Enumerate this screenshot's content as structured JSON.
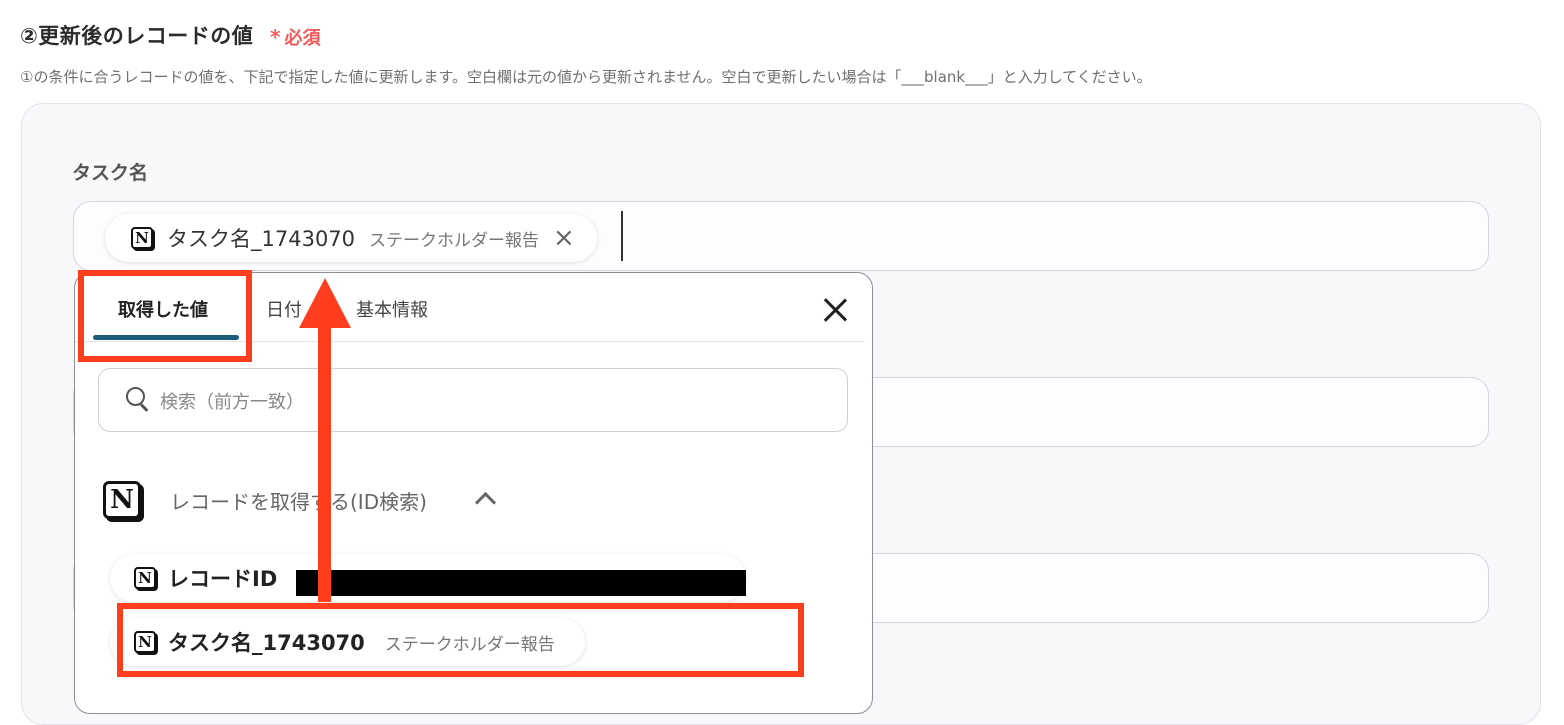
{
  "section": {
    "title": "②更新後のレコードの値",
    "required_mark": "*",
    "required_label": "必須",
    "description": "①の条件に合うレコードの値を、下記で指定した値に更新します。空白欄は元の値から更新されません。空白で更新したい場合は「___blank___」と入力してください。"
  },
  "field": {
    "label": "タスク名",
    "chip": {
      "icon": "notion-logo-icon",
      "logo_letter": "N",
      "value": "タスク名_1743070",
      "sub": "ステークホルダー報告",
      "remove_glyph": "×"
    }
  },
  "dropdown": {
    "tabs": [
      {
        "label": "取得した値",
        "active": true
      },
      {
        "label": "日付",
        "active": false
      },
      {
        "label": "基本情報",
        "active": false
      }
    ],
    "search_placeholder": "検索（前方一致）",
    "group": {
      "label": "レコードを取得する(ID検索)",
      "logo_letter": "N",
      "expanded": true
    },
    "items": [
      {
        "label": "レコードID",
        "sub": "",
        "logo_letter": "N",
        "redacted": true
      },
      {
        "label": "タスク名_1743070",
        "sub": "ステークホルダー報告",
        "logo_letter": "N",
        "redacted": false
      }
    ]
  },
  "colors": {
    "annotation_red": "#ff3d1f",
    "tab_underline": "#1e5b7a",
    "required": "#f25c5c"
  }
}
